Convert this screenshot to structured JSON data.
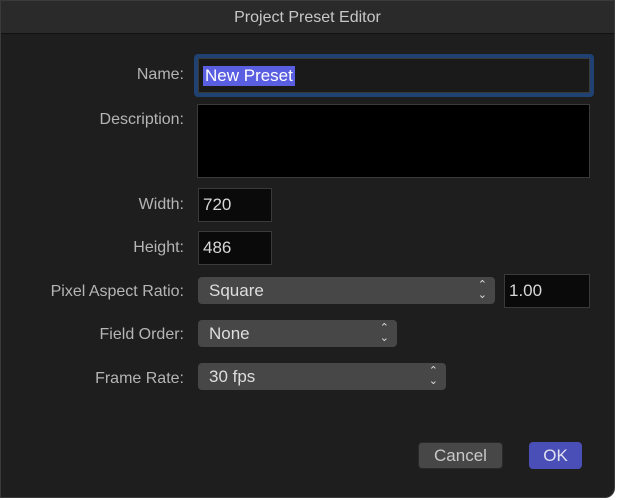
{
  "title": "Project Preset Editor",
  "name": {
    "label": "Name:",
    "value": "New Preset"
  },
  "description": {
    "label": "Description:",
    "value": ""
  },
  "width": {
    "label": "Width:",
    "value": "720"
  },
  "height": {
    "label": "Height:",
    "value": "486"
  },
  "pixel_aspect_ratio": {
    "label": "Pixel Aspect Ratio:",
    "selected": "Square",
    "value": "1.00"
  },
  "field_order": {
    "label": "Field Order:",
    "selected": "None"
  },
  "frame_rate": {
    "label": "Frame Rate:",
    "selected": "30 fps"
  },
  "buttons": {
    "cancel": "Cancel",
    "ok": "OK"
  },
  "colors": {
    "accent": "#5a5ee0",
    "ok_button": "#4a4fb8",
    "focus_ring": "#1f4272"
  }
}
